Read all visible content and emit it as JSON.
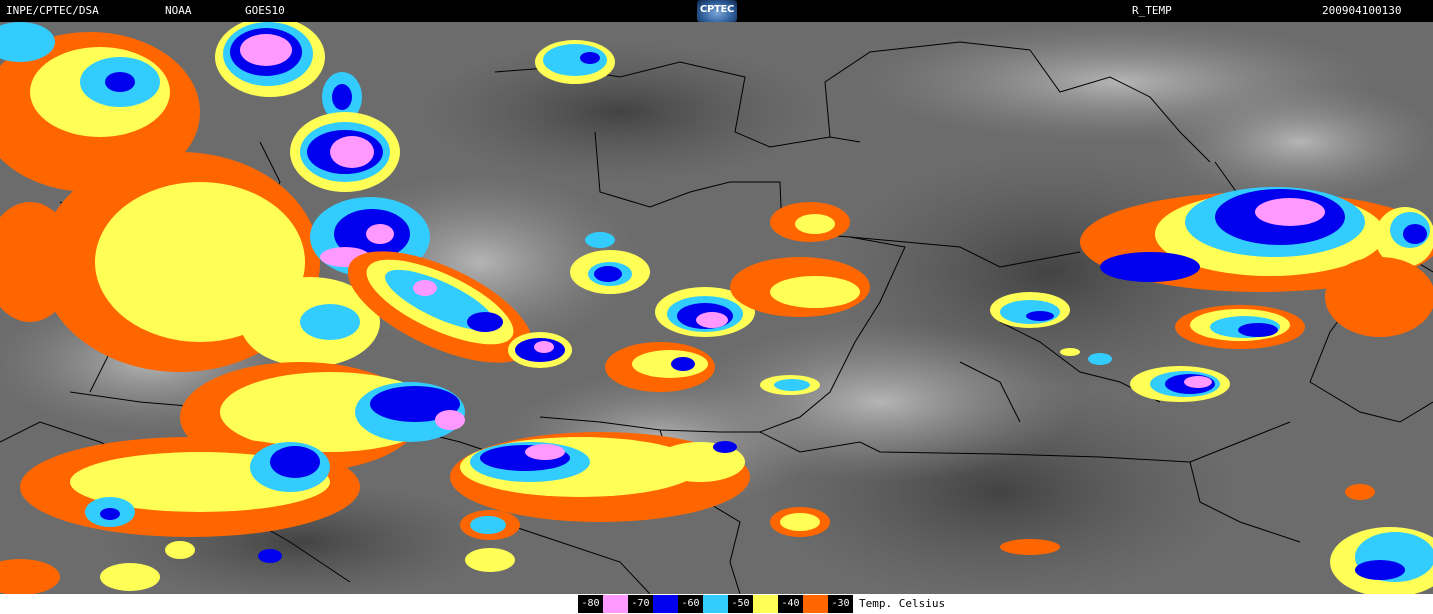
{
  "header": {
    "left_org": "INPE/CPTEC/DSA",
    "agency": "NOAA",
    "satellite": "GOES10",
    "logo_text": "CPTEC",
    "product": "R_TEMP",
    "timestamp": "200904100130"
  },
  "legend": {
    "unit": "Temp. Celsius",
    "items": [
      {
        "label": "-80",
        "color": "#ff99ff"
      },
      {
        "label": "-70",
        "color": "#0000ee"
      },
      {
        "label": "-60",
        "color": "#33ccff"
      },
      {
        "label": "-50",
        "color": "#ffff55"
      },
      {
        "label": "-40",
        "color": "#ff6600"
      },
      {
        "label": "-30",
        "color": ""
      }
    ]
  },
  "colors": {
    "background_cloud": "#6c6c6c",
    "border_lines": "#000000"
  }
}
